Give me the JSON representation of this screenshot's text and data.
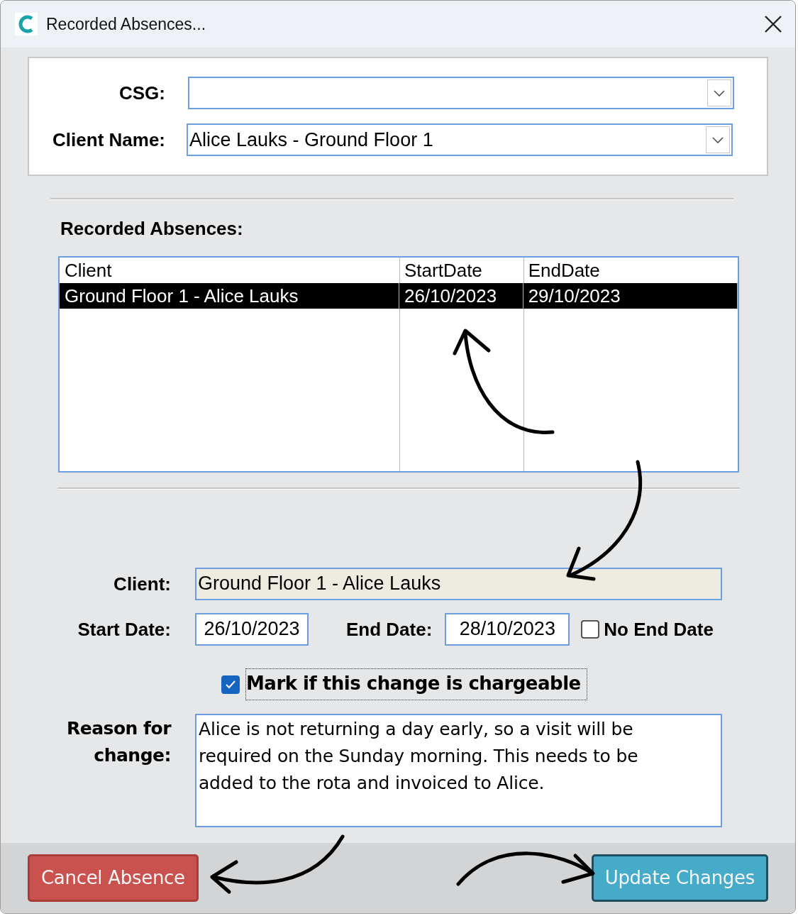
{
  "window": {
    "title": "Recorded Absences..."
  },
  "filters": {
    "csg": {
      "label": "CSG:"
    },
    "client_name": {
      "label": "Client Name:",
      "value": "Alice Lauks - Ground Floor 1"
    }
  },
  "absences": {
    "heading": "Recorded Absences:",
    "columns": [
      "Client",
      "StartDate",
      "EndDate"
    ],
    "rows": [
      {
        "cells": [
          "Ground Floor 1 - Alice Lauks",
          "26/10/2023",
          "29/10/2023"
        ],
        "selected": true
      }
    ]
  },
  "form": {
    "client": {
      "label": "Client:",
      "value": "Ground Floor 1 - Alice Lauks"
    },
    "start_date": {
      "label": "Start Date:",
      "value": "26/10/2023"
    },
    "end_date": {
      "label": "End Date:",
      "value": "28/10/2023"
    },
    "no_end_date": {
      "label": "No End Date",
      "checked": false
    },
    "chargeable": {
      "label": "Mark if this change is chargeable",
      "checked": true
    },
    "reason": {
      "label": "Reason for change:",
      "value": "Alice is not returning a day early, so a visit will be required on the Sunday morning. This needs to be added to the rota and invoiced to Alice."
    }
  },
  "buttons": [
    {
      "label": "Cancel Absence",
      "kind": "danger"
    },
    {
      "label": "Update Changes",
      "kind": "primary"
    }
  ]
}
